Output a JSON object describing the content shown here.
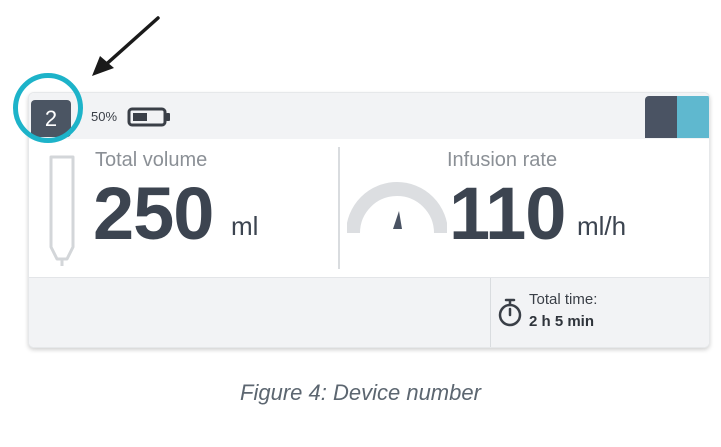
{
  "device": {
    "number": "2",
    "battery_percent": "50%"
  },
  "volume": {
    "label": "Total volume",
    "value": "250",
    "unit": "ml"
  },
  "rate": {
    "label": "Infusion rate",
    "value": "110",
    "unit": "ml/h"
  },
  "timer": {
    "label": "Total time:",
    "value": "2 h 5 min"
  },
  "caption": "Figure 4: Device number",
  "icons": {
    "arrow": "arrow-pointer-icon",
    "battery": "battery-icon",
    "syringe": "syringe-icon",
    "gauge": "gauge-icon",
    "timer": "stopwatch-icon"
  },
  "colors": {
    "badge": "#4b5563",
    "highlight": "#1db3c9",
    "accent_cyan": "#5fb8cf",
    "accent_dark": "#4a5363",
    "value_text": "#3c4450"
  }
}
